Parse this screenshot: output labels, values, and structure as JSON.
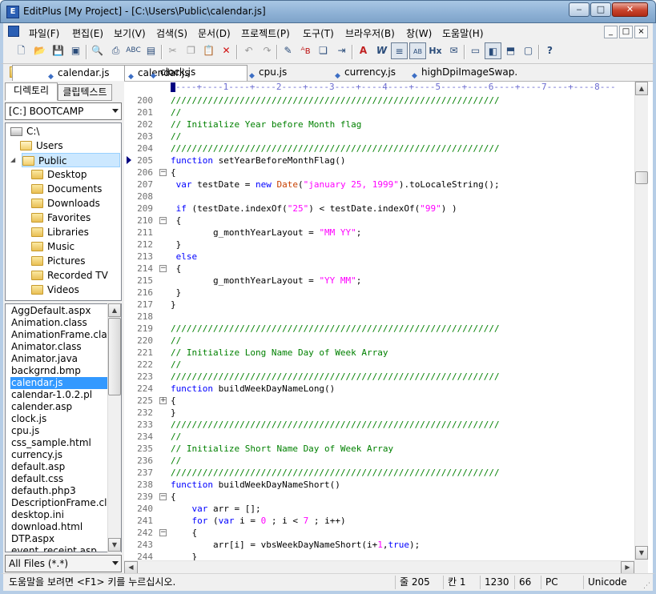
{
  "window": {
    "title": "EditPlus [My Project] - [C:\\Users\\Public\\calendar.js]",
    "icon": "editplus-app-icon"
  },
  "caption_buttons": [
    "minimize",
    "maximize",
    "close"
  ],
  "menu": {
    "items": [
      "파일(F)",
      "편집(E)",
      "보기(V)",
      "검색(S)",
      "문서(D)",
      "프로젝트(P)",
      "도구(T)",
      "브라우저(B)",
      "창(W)",
      "도움말(H)"
    ],
    "mdi_buttons": [
      "_",
      "□",
      "×"
    ]
  },
  "toolbar": {
    "icons": [
      "new-file-icon",
      "open-icon",
      "save-icon",
      "save-all-icon",
      "print-preview-icon",
      "print-icon",
      "spell-check-icon",
      "find-in-files-icon",
      "cut-icon",
      "copy-icon",
      "paste-icon",
      "delete-icon",
      "undo-icon",
      "redo-icon",
      "highlight-icon",
      "replace-icon",
      "clipboard-icon",
      "indent-icon",
      "font-icon",
      "word-wrap-icon",
      "line-number-icon",
      "column-ruler-icon",
      "hex-icon",
      "cliptext-icon",
      "window-icon",
      "directory-window-icon",
      "output-window-icon",
      "fullscreen-icon",
      "help-icon"
    ]
  },
  "sidebar": {
    "tabs": [
      "디렉토리",
      "클립텍스트"
    ],
    "drive": "[C:] BOOTCAMP",
    "tree": [
      {
        "label": "C:\\",
        "level": 0,
        "type": "drive"
      },
      {
        "label": "Users",
        "level": 1,
        "type": "folder"
      },
      {
        "label": "Public",
        "level": 2,
        "type": "folder-open",
        "selected": true
      },
      {
        "label": "Desktop",
        "level": 3,
        "type": "folder"
      },
      {
        "label": "Documents",
        "level": 3,
        "type": "folder"
      },
      {
        "label": "Downloads",
        "level": 3,
        "type": "folder"
      },
      {
        "label": "Favorites",
        "level": 3,
        "type": "folder"
      },
      {
        "label": "Libraries",
        "level": 3,
        "type": "folder"
      },
      {
        "label": "Music",
        "level": 3,
        "type": "folder"
      },
      {
        "label": "Pictures",
        "level": 3,
        "type": "folder"
      },
      {
        "label": "Recorded TV",
        "level": 3,
        "type": "folder"
      },
      {
        "label": "Videos",
        "level": 3,
        "type": "folder"
      }
    ],
    "files": [
      "AggDefault.aspx",
      "Animation.class",
      "AnimationFrame.class",
      "Animator.class",
      "Animator.java",
      "backgrnd.bmp",
      "calendar.js",
      "calendar-1.0.2.pl",
      "calender.asp",
      "clock.js",
      "cpu.js",
      "css_sample.html",
      "currency.js",
      "default.asp",
      "default.css",
      "defauth.php3",
      "DescriptionFrame.class",
      "desktop.ini",
      "download.html",
      "DTP.aspx",
      "event_receipt.asp"
    ],
    "selected_file": "calendar.js",
    "filter": "All Files (*.*)"
  },
  "doc_tabs": [
    {
      "label": "calendar.js",
      "active": true
    },
    {
      "label": "clock.js",
      "active": false
    },
    {
      "label": "cpu.js",
      "active": false
    },
    {
      "label": "currency.js",
      "active": false
    },
    {
      "label": "highDpiImageSwap.",
      "active": false
    }
  ],
  "ruler": "----+----1----+----2----+----3----+----4----+----5----+----6----+----7----+----8---",
  "editor": {
    "lines": [
      {
        "n": "200",
        "fold": "",
        "segs": [
          [
            "//////////////////////////////////////////////////////////////",
            "com"
          ]
        ]
      },
      {
        "n": "201",
        "fold": "",
        "segs": [
          [
            "//",
            "com"
          ]
        ]
      },
      {
        "n": "202",
        "fold": "",
        "segs": [
          [
            "// Initialize Year before Month flag",
            "com"
          ]
        ]
      },
      {
        "n": "203",
        "fold": "",
        "segs": [
          [
            "//",
            "com"
          ]
        ]
      },
      {
        "n": "204",
        "fold": "",
        "segs": [
          [
            "//////////////////////////////////////////////////////////////",
            "com"
          ]
        ]
      },
      {
        "n": "205",
        "fold": "",
        "segs": [
          [
            "function",
            "kw"
          ],
          [
            " setYearBeforeMonthFlag()",
            ""
          ]
        ]
      },
      {
        "n": "206",
        "fold": "minus",
        "segs": [
          [
            "{",
            ""
          ]
        ]
      },
      {
        "n": "207",
        "fold": "",
        "segs": [
          [
            " ",
            ""
          ],
          [
            "var",
            "kw"
          ],
          [
            " testDate = ",
            ""
          ],
          [
            "new",
            "kw"
          ],
          [
            " ",
            ""
          ],
          [
            "Date",
            "fn"
          ],
          [
            "(",
            ""
          ],
          [
            "\"january 25, 1999\"",
            "str"
          ],
          [
            ").toLocaleString();",
            ""
          ]
        ]
      },
      {
        "n": "208",
        "fold": "",
        "segs": [
          [
            "",
            ""
          ]
        ]
      },
      {
        "n": "209",
        "fold": "",
        "segs": [
          [
            " ",
            ""
          ],
          [
            "if",
            "kw"
          ],
          [
            " (testDate.indexOf(",
            ""
          ],
          [
            "\"25\"",
            "str"
          ],
          [
            ") < testDate.indexOf(",
            ""
          ],
          [
            "\"99\"",
            "str"
          ],
          [
            ") )",
            ""
          ]
        ]
      },
      {
        "n": "210",
        "fold": "minus",
        "segs": [
          [
            " {",
            ""
          ]
        ]
      },
      {
        "n": "211",
        "fold": "",
        "segs": [
          [
            "        g_monthYearLayout = ",
            ""
          ],
          [
            "\"MM YY\"",
            "str"
          ],
          [
            ";",
            ""
          ]
        ]
      },
      {
        "n": "212",
        "fold": "",
        "segs": [
          [
            " }",
            ""
          ]
        ]
      },
      {
        "n": "213",
        "fold": "",
        "segs": [
          [
            " ",
            ""
          ],
          [
            "else",
            "kw"
          ]
        ]
      },
      {
        "n": "214",
        "fold": "minus",
        "segs": [
          [
            " {",
            ""
          ]
        ]
      },
      {
        "n": "215",
        "fold": "",
        "segs": [
          [
            "        g_monthYearLayout = ",
            ""
          ],
          [
            "\"YY MM\"",
            "str"
          ],
          [
            ";",
            ""
          ]
        ]
      },
      {
        "n": "216",
        "fold": "",
        "segs": [
          [
            " }",
            ""
          ]
        ]
      },
      {
        "n": "217",
        "fold": "",
        "segs": [
          [
            "}",
            ""
          ]
        ]
      },
      {
        "n": "218",
        "fold": "",
        "segs": [
          [
            "",
            ""
          ]
        ]
      },
      {
        "n": "219",
        "fold": "",
        "segs": [
          [
            "//////////////////////////////////////////////////////////////",
            "com"
          ]
        ]
      },
      {
        "n": "220",
        "fold": "",
        "segs": [
          [
            "//",
            "com"
          ]
        ]
      },
      {
        "n": "221",
        "fold": "",
        "segs": [
          [
            "// Initialize Long Name Day of Week Array",
            "com"
          ]
        ]
      },
      {
        "n": "222",
        "fold": "",
        "segs": [
          [
            "//",
            "com"
          ]
        ]
      },
      {
        "n": "223",
        "fold": "",
        "segs": [
          [
            "//////////////////////////////////////////////////////////////",
            "com"
          ]
        ]
      },
      {
        "n": "224",
        "fold": "",
        "segs": [
          [
            "function",
            "kw"
          ],
          [
            " buildWeekDayNameLong()",
            ""
          ]
        ]
      },
      {
        "n": "225",
        "fold": "plus",
        "segs": [
          [
            "{",
            ""
          ]
        ]
      },
      {
        "n": "232",
        "fold": "",
        "segs": [
          [
            "}",
            ""
          ]
        ]
      },
      {
        "n": "233",
        "fold": "",
        "segs": [
          [
            "//////////////////////////////////////////////////////////////",
            "com"
          ]
        ]
      },
      {
        "n": "234",
        "fold": "",
        "segs": [
          [
            "//",
            "com"
          ]
        ]
      },
      {
        "n": "235",
        "fold": "",
        "segs": [
          [
            "// Initialize Short Name Day of Week Array",
            "com"
          ]
        ]
      },
      {
        "n": "236",
        "fold": "",
        "segs": [
          [
            "//",
            "com"
          ]
        ]
      },
      {
        "n": "237",
        "fold": "",
        "segs": [
          [
            "//////////////////////////////////////////////////////////////",
            "com"
          ]
        ]
      },
      {
        "n": "238",
        "fold": "",
        "segs": [
          [
            "function",
            "kw"
          ],
          [
            " buildWeekDayNameShort()",
            ""
          ]
        ]
      },
      {
        "n": "239",
        "fold": "minus",
        "segs": [
          [
            "{",
            ""
          ]
        ]
      },
      {
        "n": "240",
        "fold": "",
        "segs": [
          [
            "    ",
            ""
          ],
          [
            "var",
            "kw"
          ],
          [
            " arr = [];",
            ""
          ]
        ]
      },
      {
        "n": "241",
        "fold": "",
        "segs": [
          [
            "    ",
            ""
          ],
          [
            "for",
            "kw"
          ],
          [
            " (",
            ""
          ],
          [
            "var",
            "kw"
          ],
          [
            " i = ",
            ""
          ],
          [
            "0",
            "str"
          ],
          [
            " ; i < ",
            ""
          ],
          [
            "7",
            "str"
          ],
          [
            " ; i++)",
            ""
          ]
        ]
      },
      {
        "n": "242",
        "fold": "minus",
        "segs": [
          [
            "    {",
            ""
          ]
        ]
      },
      {
        "n": "243",
        "fold": "",
        "segs": [
          [
            "        arr[i] = vbsWeekDayNameShort(i+",
            ""
          ],
          [
            "1",
            "str"
          ],
          [
            ",",
            ""
          ],
          [
            "true",
            "kw"
          ],
          [
            ");",
            ""
          ]
        ]
      },
      {
        "n": "244",
        "fold": "",
        "segs": [
          [
            "    }",
            ""
          ]
        ]
      }
    ]
  },
  "status": {
    "help": "도움말을 보려면 <F1> 키를 누르십시오.",
    "line": "줄 205",
    "col": "칸 1",
    "size": "1230",
    "num": "66",
    "mode": "PC",
    "encoding": "Unicode"
  }
}
